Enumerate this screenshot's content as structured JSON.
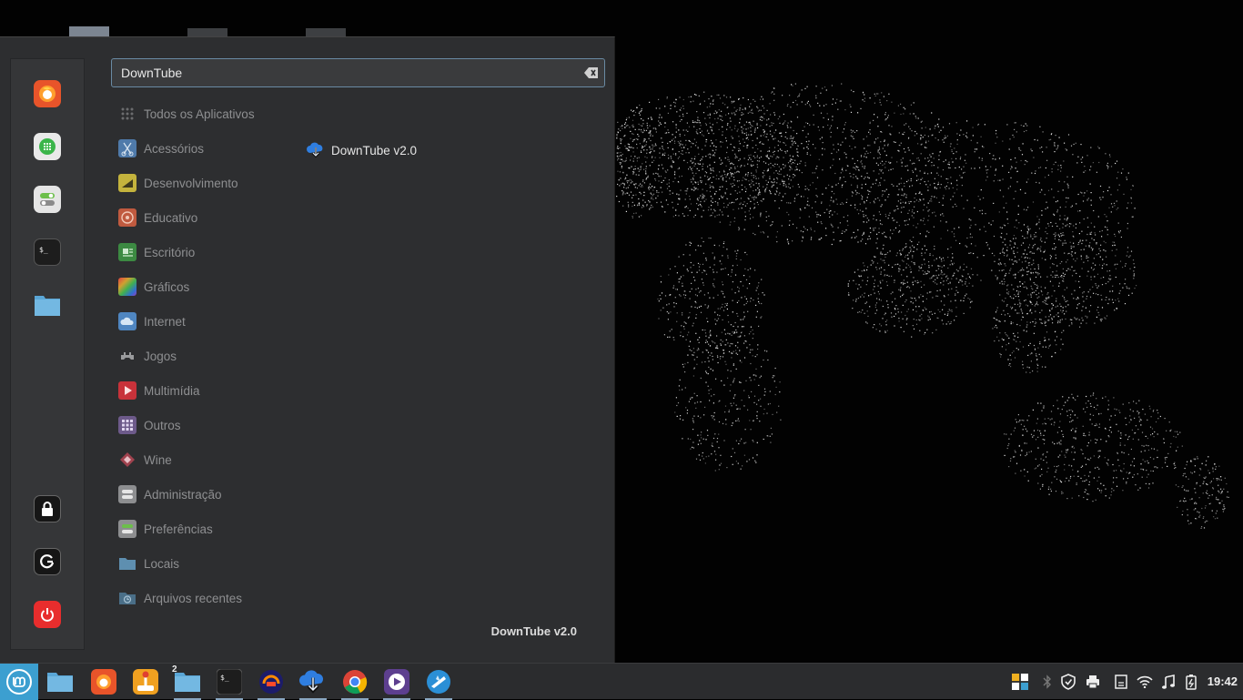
{
  "search": {
    "value": "DownTube",
    "placeholder": ""
  },
  "categories": [
    {
      "label": "Todos os Aplicativos",
      "icon": "grid-icon"
    },
    {
      "label": "Acessórios",
      "icon": "scissors-icon"
    },
    {
      "label": "Desenvolvimento",
      "icon": "wrench-icon"
    },
    {
      "label": "Educativo",
      "icon": "education-icon"
    },
    {
      "label": "Escritório",
      "icon": "office-icon"
    },
    {
      "label": "Gráficos",
      "icon": "graphics-icon"
    },
    {
      "label": "Internet",
      "icon": "cloud-icon"
    },
    {
      "label": "Jogos",
      "icon": "gamepad-icon"
    },
    {
      "label": "Multimídia",
      "icon": "play-icon"
    },
    {
      "label": "Outros",
      "icon": "other-icon"
    },
    {
      "label": "Wine",
      "icon": "wine-icon"
    },
    {
      "label": "Administração",
      "icon": "admin-toggle-icon"
    },
    {
      "label": "Preferências",
      "icon": "preferences-icon"
    },
    {
      "label": "Locais",
      "icon": "folder-icon"
    },
    {
      "label": "Arquivos recentes",
      "icon": "recent-folder-icon"
    }
  ],
  "results": [
    {
      "label": "DownTube v2.0",
      "icon": "downtube-icon"
    }
  ],
  "app_description": "DownTube v2.0",
  "favorites": [
    "firefox-icon",
    "calculator-icon",
    "settings-toggle-icon",
    "terminal-icon",
    "files-icon"
  ],
  "session": [
    "lock-icon",
    "logout-icon",
    "power-icon"
  ],
  "taskbar": {
    "workspace_count": "2",
    "clock": "19:42",
    "apps": [
      "files-icon",
      "firefox-icon",
      "joystick-icon",
      "files-icon",
      "terminal-icon",
      "audacity-icon",
      "downtube-icon",
      "chrome-icon",
      "media-player-icon",
      "browser-icon"
    ]
  },
  "colors": {
    "accent": "#3c9fd0",
    "menu_bg": "#2d2e30",
    "panel_bg": "#2b2c2e"
  }
}
